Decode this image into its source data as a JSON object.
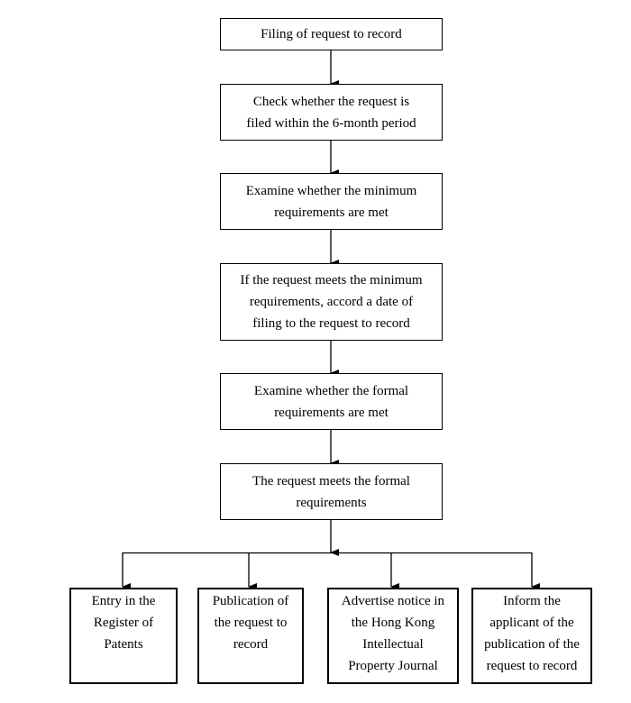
{
  "flowchart": {
    "steps": [
      {
        "label": "Filing of request to record"
      },
      {
        "label": "Check whether the request is\nfiled within the 6-month period"
      },
      {
        "label": "Examine whether the minimum\nrequirements are met"
      },
      {
        "label": "If the request meets the minimum\nrequirements, accord a date of\nfiling to the request to record"
      },
      {
        "label": "Examine whether the formal\nrequirements are met"
      },
      {
        "label": "The request meets the formal\nrequirements"
      }
    ],
    "outcomes": [
      {
        "label": "Entry in the\nRegister of\nPatents"
      },
      {
        "label": "Publication of\nthe request to\nrecord"
      },
      {
        "label": "Advertise notice in\nthe Hong Kong\nIntellectual\nProperty Journal"
      },
      {
        "label": "Inform the\napplicant of the\npublication of the\nrequest to record"
      }
    ]
  }
}
